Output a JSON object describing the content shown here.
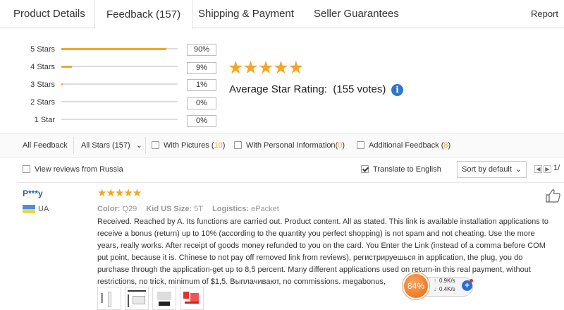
{
  "tabs": {
    "product_details": "Product Details",
    "feedback": "Feedback (157)",
    "shipping": "Shipping & Payment",
    "guarantees": "Seller Guarantees",
    "report": "Report"
  },
  "rating": {
    "histogram": [
      {
        "label": "5 Stars",
        "percent_text": "90%",
        "fraction": 0.9
      },
      {
        "label": "4 Stars",
        "percent_text": "9%",
        "fraction": 0.09
      },
      {
        "label": "3 Stars",
        "percent_text": "1%",
        "fraction": 0.01
      },
      {
        "label": "2 Stars",
        "percent_text": "0%",
        "fraction": 0.0
      },
      {
        "label": "1 Star",
        "percent_text": "0%",
        "fraction": 0.0
      }
    ],
    "stars": "★★★★★",
    "average_label": "Average Star Rating:",
    "votes": "(155 votes)",
    "info_glyph": "i"
  },
  "filters": {
    "all_feedback": "All Feedback",
    "all_stars": "All Stars (157)",
    "with_pictures": "With Pictures",
    "with_pictures_count": "10",
    "with_personal": "With Personal Information",
    "with_personal_count": "0",
    "additional": "Additional Feedback",
    "additional_count": "8",
    "view_russia": "View reviews from Russia",
    "translate": "Translate to English",
    "translate_checked": true,
    "sort": "Sort by default",
    "pager": "1/"
  },
  "review": {
    "name": "P***y",
    "country": "UA",
    "stars": "★★★★★",
    "color_label": "Color:",
    "color_value": "Q29",
    "size_label": "Kid US Size:",
    "size_value": "5T",
    "logistics_label": "Logistics:",
    "logistics_value": "ePacket",
    "lines": [
      "Received. Reached by A. Its functions are carried out. Product content. All as stated. This link is available installation applications to",
      "receive a bonus (return) up to 10% (according to the quantity you perfect shopping) is not spam and not cheating. Use the more",
      "years, really works. After receipt of goods money refunded to you on the card. You Enter the Link (instead of a comma before COM",
      "put point, because it is. Chinese to not pay off removed link from reviews), регистрируешься in application, the plug, you do",
      "purchase through the application-get up to 8,5 percent. Many different applications used on return-in this real payment, without",
      "restrictions, no trick, minimum of $1,5. Выплачивают, no commissions. megabonus,"
    ]
  },
  "net_widget": {
    "percent": "84%",
    "up": "0.9K/s",
    "down": "0.4K/s",
    "plus": "+"
  },
  "colors": {
    "star": "#f5a623",
    "link": "#2a5db0",
    "accent_orange": "#e86b17"
  }
}
